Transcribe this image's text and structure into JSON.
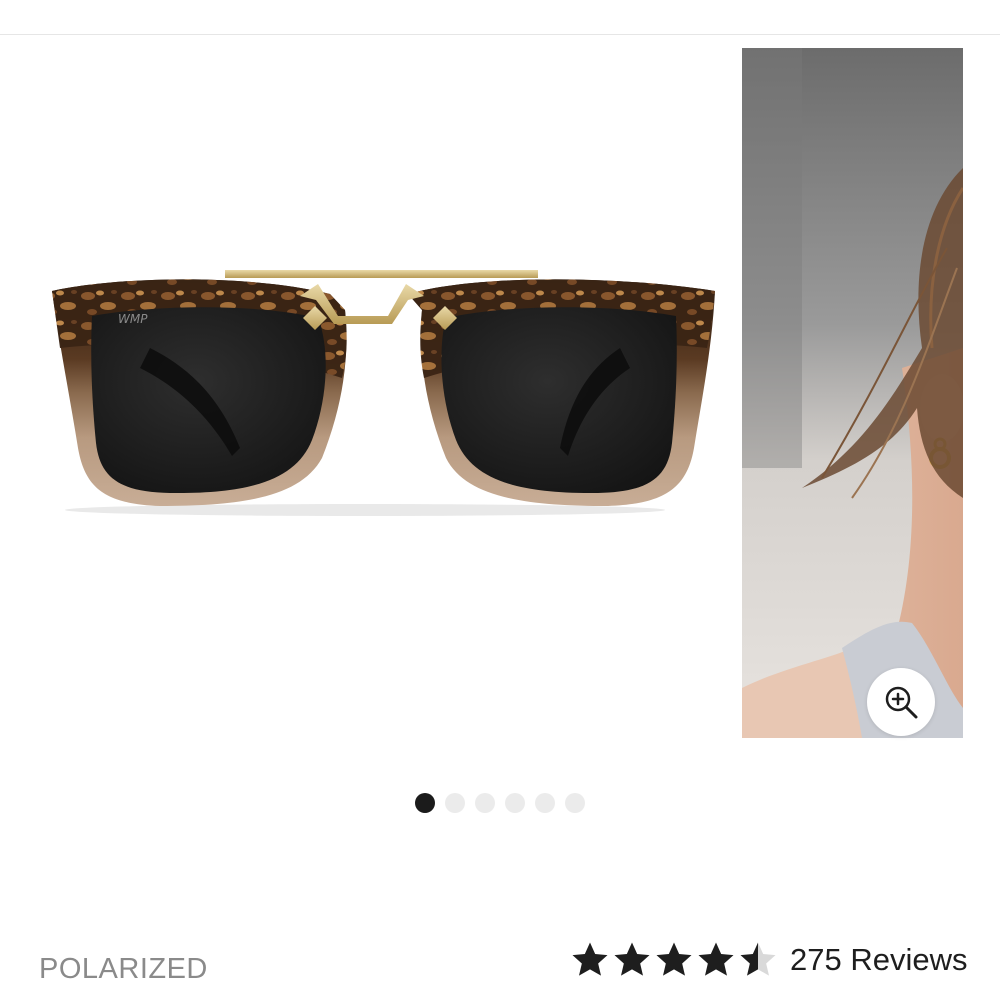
{
  "product": {
    "feature_label": "POLARIZED",
    "rating": {
      "stars": 4.5,
      "max_stars": 5,
      "reviews_text": "275 Reviews"
    },
    "lens_logo": "WMP"
  },
  "gallery": {
    "slide_count": 6,
    "active_slide": 1,
    "zoom_icon": "zoom-in-icon"
  },
  "colors": {
    "active_dot": "#1b1b1b",
    "inactive_dot": "#ebebeb",
    "star": "#1e1e1e",
    "label_gray": "#8a8a8a"
  }
}
